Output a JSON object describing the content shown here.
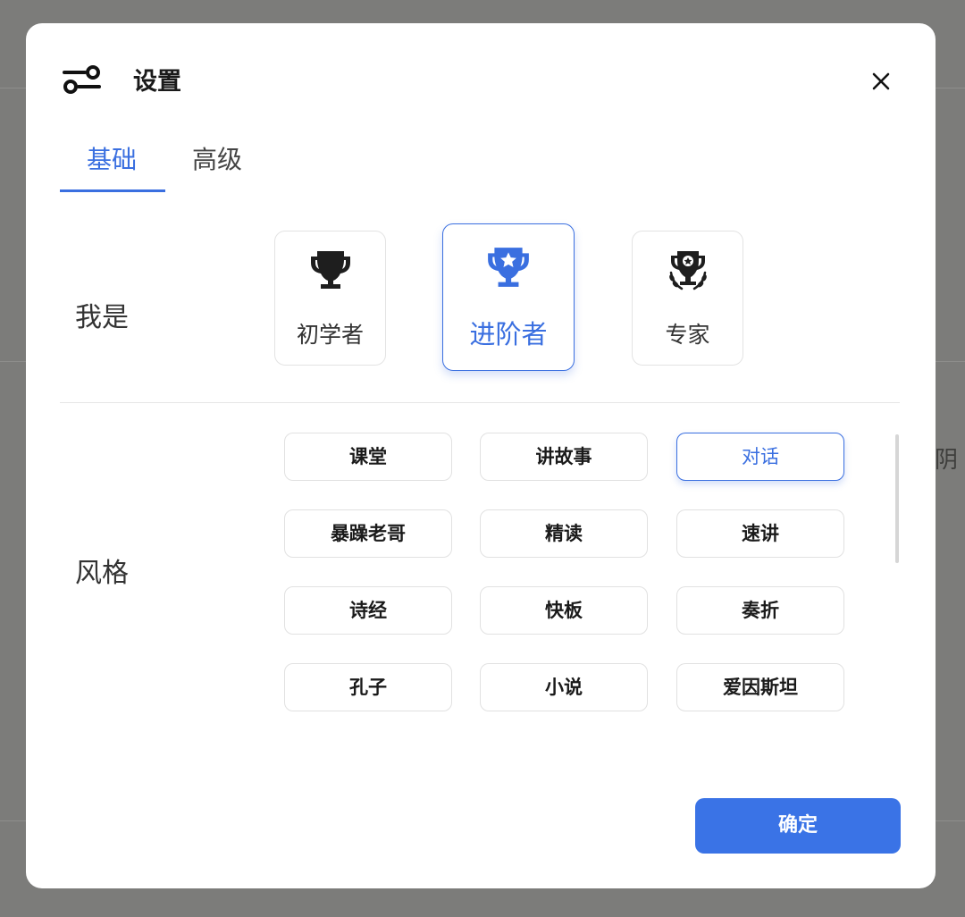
{
  "background": {
    "partial_text": "阴"
  },
  "dialog": {
    "title": "设置",
    "header_icon": "sliders-icon",
    "close_icon": "close-icon"
  },
  "tabs": [
    {
      "label": "基础",
      "active": true
    },
    {
      "label": "高级",
      "active": false
    }
  ],
  "level": {
    "label": "我是",
    "options": [
      {
        "label": "初学者",
        "icon": "trophy-icon",
        "selected": false
      },
      {
        "label": "进阶者",
        "icon": "trophy-star-icon",
        "selected": true
      },
      {
        "label": "专家",
        "icon": "trophy-laurel-icon",
        "selected": false
      }
    ]
  },
  "style": {
    "label": "风格",
    "options": [
      {
        "label": "课堂",
        "selected": false
      },
      {
        "label": "讲故事",
        "selected": false
      },
      {
        "label": "对话",
        "selected": true
      },
      {
        "label": "暴躁老哥",
        "selected": false
      },
      {
        "label": "精读",
        "selected": false
      },
      {
        "label": "速讲",
        "selected": false
      },
      {
        "label": "诗经",
        "selected": false
      },
      {
        "label": "快板",
        "selected": false
      },
      {
        "label": "奏折",
        "selected": false
      },
      {
        "label": "孔子",
        "selected": false
      },
      {
        "label": "小说",
        "selected": false
      },
      {
        "label": "爱因斯坦",
        "selected": false
      }
    ]
  },
  "footer": {
    "confirm_label": "确定"
  },
  "colors": {
    "accent": "#3a6fe0",
    "backdrop": "#7c7c7a"
  }
}
